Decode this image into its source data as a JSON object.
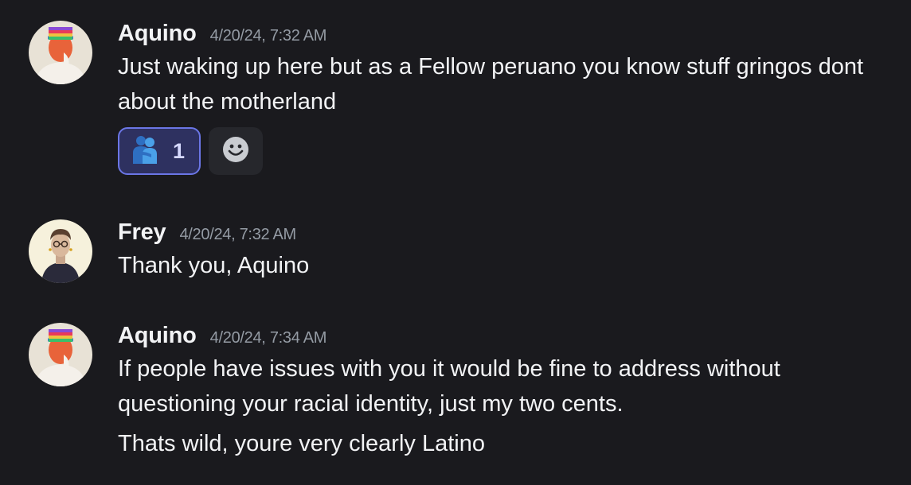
{
  "messages": [
    {
      "author": "Aquino",
      "timestamp": "4/20/24, 7:32 AM",
      "avatar_icon": "aquino-avatar",
      "lines": [
        "Just waking up here but as a Fellow peruano you know stuff gringos dont about the motherland"
      ],
      "reactions": [
        {
          "icon": "people-hugging-emoji",
          "count": "1",
          "active": true
        }
      ],
      "add_reaction_icon": "add-reaction-smiley-icon"
    },
    {
      "author": "Frey",
      "timestamp": "4/20/24, 7:32 AM",
      "avatar_icon": "frey-avatar",
      "lines": [
        "Thank you, Aquino"
      ]
    },
    {
      "author": "Aquino",
      "timestamp": "4/20/24, 7:34 AM",
      "avatar_icon": "aquino-avatar",
      "lines": [
        "If people have issues with you it would be fine to address without questioning your racial identity, just my two cents.",
        "Thats wild, youre very clearly Latino"
      ]
    }
  ],
  "colors": {
    "background": "#1a1a1e",
    "text": "#f2f3f5",
    "timestamp": "#949ba4",
    "reaction_active_bg": "#2e3160",
    "reaction_active_border": "#6b76e6"
  }
}
